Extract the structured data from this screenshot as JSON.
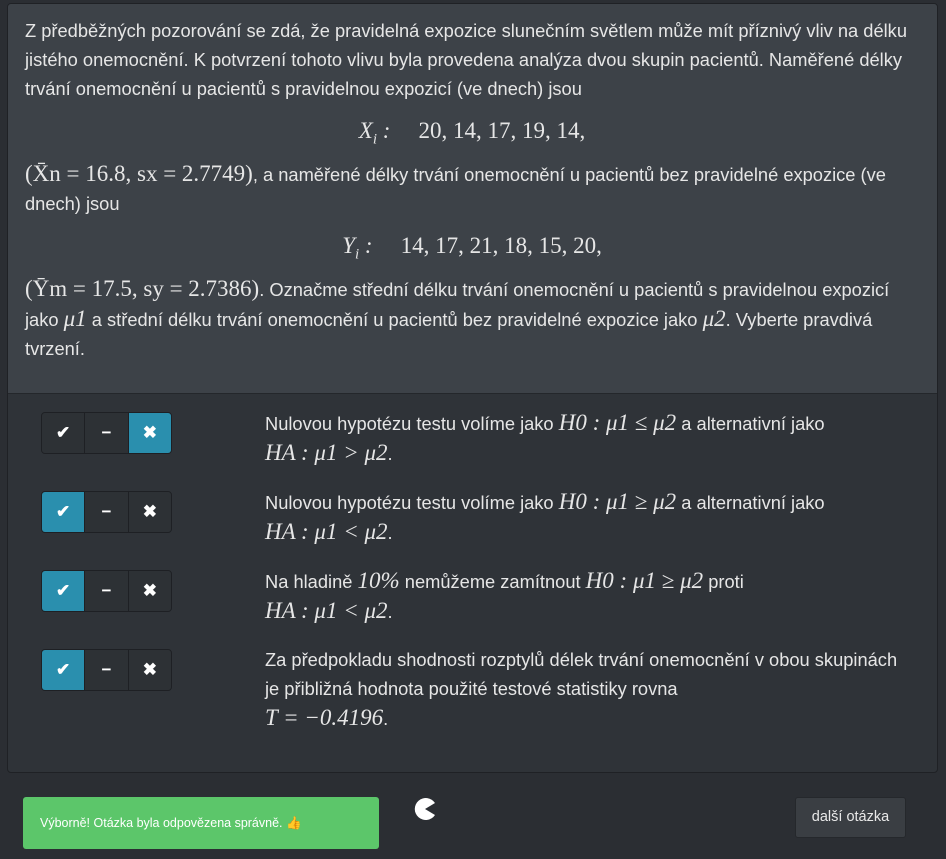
{
  "question": {
    "intro": "Z předběžných pozorování se zdá, že pravidelná expozice slunečním světlem může mít příznivý vliv na délku jistého onemocnění. K potvrzení tohoto vlivu byla provedena analýza dvou skupin pacientů. Naměřené délky trvání onemocnění u pacientů s pravidelnou expozicí (ve dnech) jsou",
    "x_label": "X",
    "x_sub": "i",
    "x_values": "20, 14, 17, 19, 14,",
    "x_stats": "(X̄n = 16.8, sx = 2.7749)",
    "mid_text": ", a naměřené délky trvání onemocnění u pacientů bez pravidelné expozice (ve dnech) jsou",
    "y_label": "Y",
    "y_sub": "i",
    "y_values": "14, 17, 21, 18, 15, 20,",
    "y_stats": "(Ȳm = 17.5, sy = 2.7386)",
    "end_text_1": ". Označme střední délku trvání onemocnění u pacientů s pravidelnou expozicí jako",
    "mu1": "μ1",
    "end_text_2": "a střední délku trvání onemocnění u pacientů bez pravidelné expozice jako",
    "mu2": "μ2",
    "end_text_3": ". Vyberte pravdivá tvrzení."
  },
  "answers": [
    {
      "selected": "false",
      "text_a": "Nulovou hypotézu testu volíme jako",
      "math_a": "H0 : μ1 ≤ μ2",
      "text_b": "a alternativní jako",
      "math_b": "HA : μ1 > μ2",
      "tail": "."
    },
    {
      "selected": "true",
      "text_a": "Nulovou hypotézu testu volíme jako",
      "math_a": "H0 : μ1 ≥ μ2",
      "text_b": "a alternativní jako",
      "math_b": "HA : μ1 < μ2",
      "tail": "."
    },
    {
      "selected": "true",
      "text_a": "Na hladině",
      "math_pct": "10%",
      "text_a2": "nemůžeme zamítnout",
      "math_a": "H0 : μ1 ≥ μ2",
      "text_b": "proti",
      "math_b": "HA : μ1 < μ2",
      "tail": "."
    },
    {
      "selected": "true",
      "text_a": "Za předpokladu shodnosti rozptylů délek trvání onemocnění v obou skupinách je přibližná hodnota použité testové statistiky rovna",
      "math_b": "T = −0.4196",
      "tail": "."
    }
  ],
  "buttons": {
    "true_icon": "✔",
    "neutral_icon": "−",
    "false_icon": "✖"
  },
  "feedback": {
    "message": "Výborně! Otázka byla odpovězena správně.",
    "icon": "👍"
  },
  "next_button": "další otázka",
  "colors": {
    "selected": "#2a8fae",
    "success": "#5cc66a"
  }
}
